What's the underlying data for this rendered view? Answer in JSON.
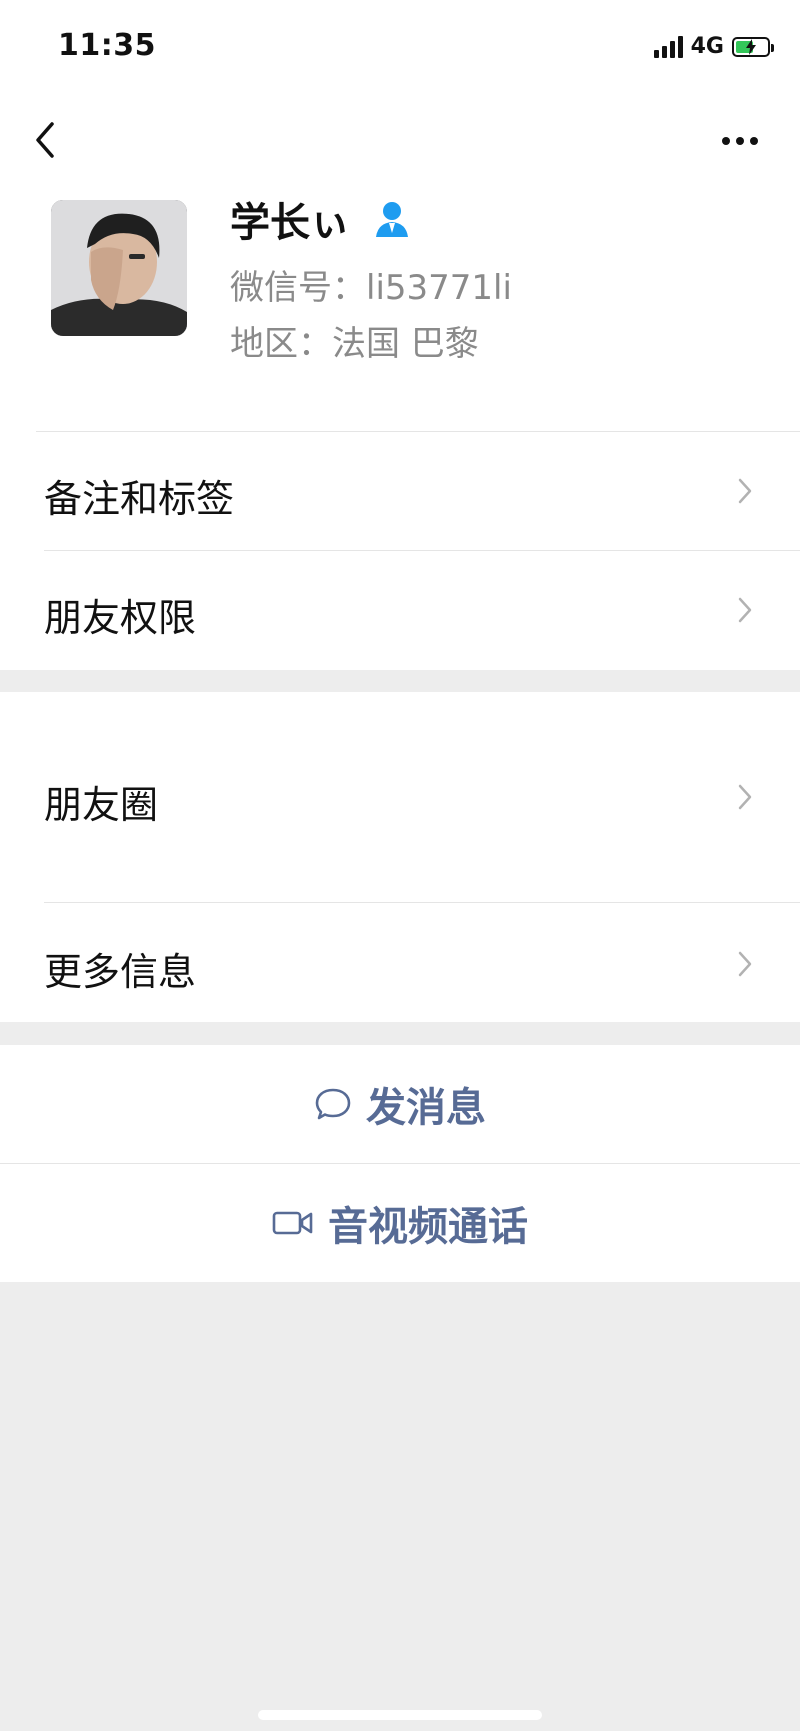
{
  "status_bar": {
    "time": "11:35",
    "network": "4G",
    "battery_level": 0.6
  },
  "header": {
    "name": "学长ぃ",
    "wechat_id": "微信号：li53771li",
    "region": "地区：法国 巴黎"
  },
  "menu_group_1": {
    "items": [
      {
        "label": "备注和标签"
      },
      {
        "label": "朋友权限"
      }
    ]
  },
  "menu_group_2": {
    "items": [
      {
        "label": "朋友圈"
      },
      {
        "label": "更多信息"
      }
    ]
  },
  "actions": {
    "message": "发消息",
    "call": "音视频通话"
  },
  "colors": {
    "link_blue": "#576b95",
    "contact_icon_blue": "#1e9cf0",
    "background": "#ededed",
    "battery_green": "#34c759"
  }
}
